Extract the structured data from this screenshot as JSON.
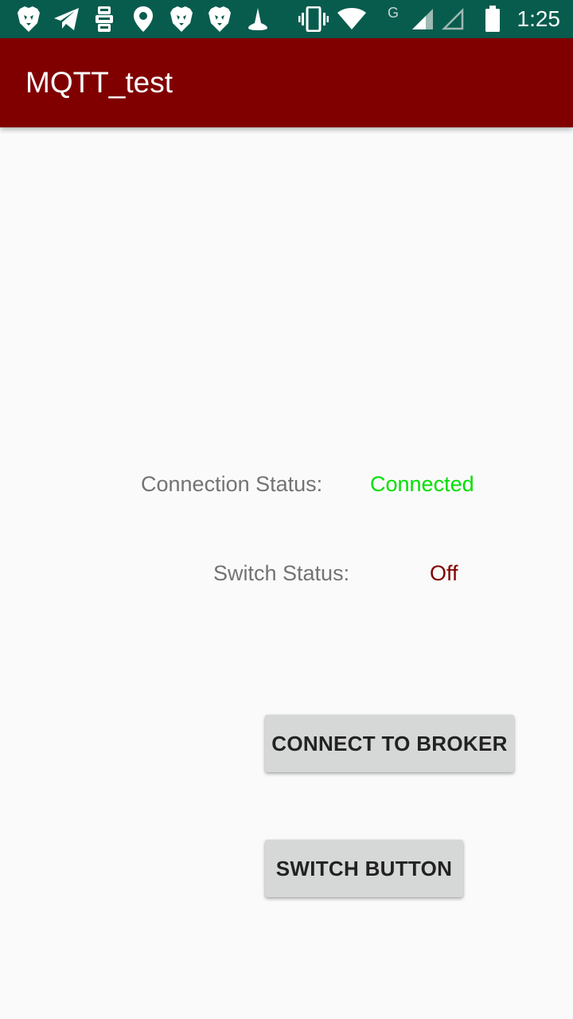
{
  "status_bar": {
    "time": "1:25",
    "network_label": "G",
    "icons": [
      "brave-lion-icon",
      "telegram-icon",
      "sim-toolkit-icon",
      "location-pin-icon",
      "brave-lion-icon",
      "brave-lion-icon",
      "cone-icon",
      "vibrate-icon",
      "wifi-icon",
      "signal-icon",
      "signal-empty-icon",
      "battery-icon"
    ]
  },
  "app_bar": {
    "title": "MQTT_test",
    "color": "#800000"
  },
  "main": {
    "connection_status_label": "Connection Status:",
    "connection_status_value": "Connected",
    "connection_status_color": "#00e000",
    "switch_status_label": "Switch Status:",
    "switch_status_value": "Off",
    "switch_status_color": "#800000",
    "connect_button_label": "CONNECT TO BROKER",
    "switch_button_label": "SWITCH BUTTON"
  }
}
